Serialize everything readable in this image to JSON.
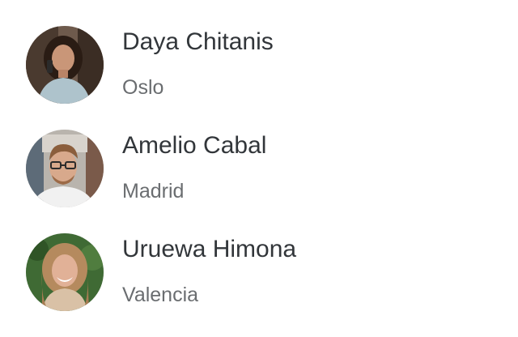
{
  "contacts": [
    {
      "name": "Daya Chitanis",
      "city": "Oslo",
      "avatar_icon": "person-photo-avatar"
    },
    {
      "name": "Amelio Cabal",
      "city": "Madrid",
      "avatar_icon": "person-photo-avatar"
    },
    {
      "name": "Uruewa Himona",
      "city": "Valencia",
      "avatar_icon": "person-photo-avatar"
    }
  ],
  "colors": {
    "name_text": "#32363a",
    "city_text": "#6a6d70",
    "background": "#ffffff"
  }
}
